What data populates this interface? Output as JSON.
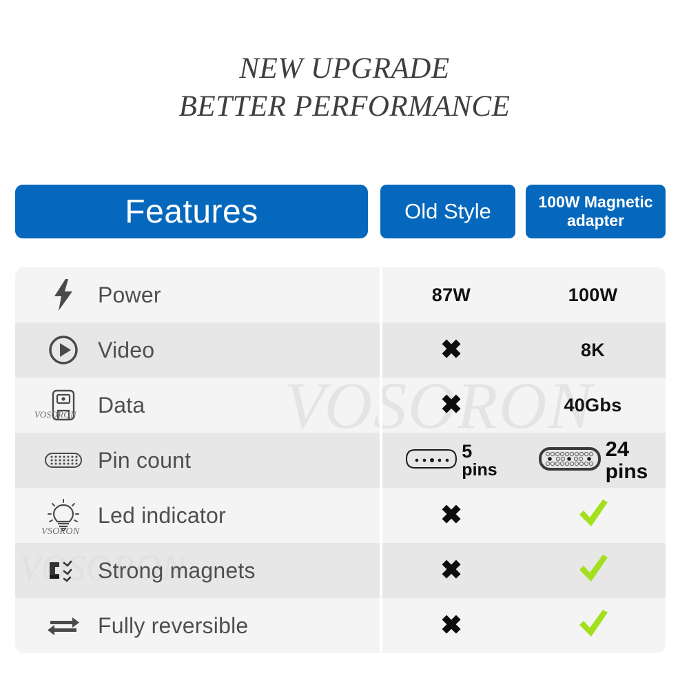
{
  "title": {
    "line1": "NEW UPGRADE",
    "line2": "BETTER PERFORMANCE"
  },
  "colors": {
    "header_blue": "#0668BC",
    "check_green": "#A2E01E",
    "row_light": "#F4F4F4",
    "row_dark": "#E7E7E7",
    "icon_gray": "#4A4A4A",
    "label_gray": "#4F4F4F"
  },
  "header": {
    "features_label": "Features",
    "old_label": "Old Style",
    "new_label_line1": "100W Magnetic",
    "new_label_line2": "adapter"
  },
  "watermarks": {
    "big": "VOSORON",
    "mid": "VOSORON",
    "data_icon": "VOSORON",
    "led_icon": "VSORON"
  },
  "rows": [
    {
      "feature": "Power",
      "icon": "lightning-bolt-icon",
      "old": "87W",
      "old_type": "text",
      "new": "100W",
      "new_type": "text"
    },
    {
      "feature": "Video",
      "icon": "play-circle-icon",
      "old": "✖",
      "old_type": "cross",
      "new": "8K",
      "new_type": "text"
    },
    {
      "feature": "Data",
      "icon": "storage-disk-icon",
      "old": "✖",
      "old_type": "cross",
      "new": "40Gbs",
      "new_type": "text"
    },
    {
      "feature": "Pin count",
      "icon": "connector-pins-icon",
      "old": "5 pins",
      "old_type": "pins",
      "old_pin_count": "5",
      "old_pin_unit": "pins",
      "new": "24 pins",
      "new_type": "pins",
      "new_pin_count": "24",
      "new_pin_unit": "pins"
    },
    {
      "feature": "Led indicator",
      "icon": "lightbulb-icon",
      "old": "✖",
      "old_type": "cross",
      "new": "✔",
      "new_type": "check"
    },
    {
      "feature": "Strong magnets",
      "icon": "magnet-icon",
      "old": "✖",
      "old_type": "cross",
      "new": "✔",
      "new_type": "check"
    },
    {
      "feature": "Fully reversible",
      "icon": "reversible-arrows-icon",
      "old": "✖",
      "old_type": "cross",
      "new": "✔",
      "new_type": "check"
    }
  ]
}
